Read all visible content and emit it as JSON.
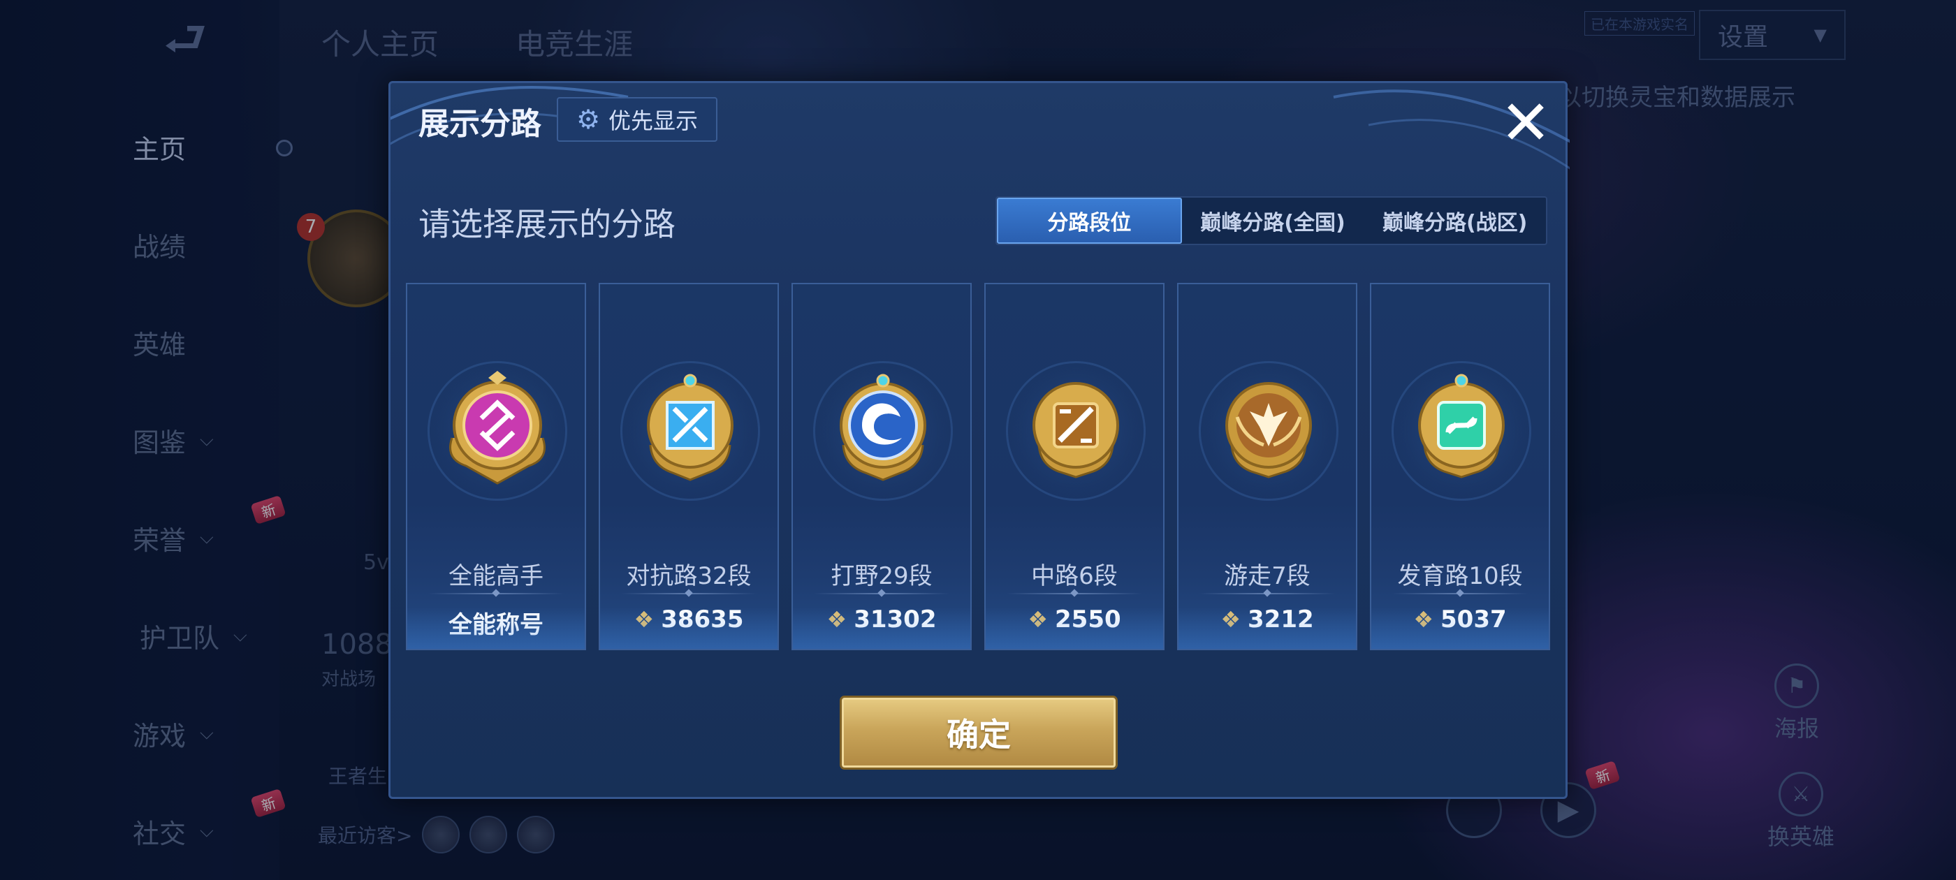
{
  "background": {
    "back_icon": "back-arrow-icon",
    "top_tabs": [
      "个人主页",
      "电竞生涯"
    ],
    "settings_label": "设置",
    "top_tag": "已在本游戏实名",
    "hint_text": "以切换灵宝和数据展示",
    "nav": [
      {
        "label": "主页",
        "has_chevron": false
      },
      {
        "label": "战绩",
        "has_chevron": false
      },
      {
        "label": "英雄",
        "has_chevron": false
      },
      {
        "label": "图鉴",
        "has_chevron": true
      },
      {
        "label": "荣誉",
        "has_chevron": true,
        "badge": "新"
      },
      {
        "label": "护卫队",
        "has_chevron": true
      },
      {
        "label": "游戏",
        "has_chevron": true
      },
      {
        "label": "社交",
        "has_chevron": true,
        "badge": "新"
      }
    ],
    "profile": {
      "level_badge": "7",
      "mode_text": "5v",
      "battle_count": "1088",
      "battle_label": "对战场",
      "kings_label": "王者生"
    },
    "recent_visitors_label": "最近访客>",
    "right_buttons": [
      {
        "label": "海报"
      },
      {
        "label": "换英雄"
      }
    ],
    "new_badge_right": "新"
  },
  "modal": {
    "title": "展示分路",
    "priority_label": "优先显示",
    "close_icon": "close-icon",
    "subtitle": "请选择展示的分路",
    "tabs": [
      {
        "label": "分路段位",
        "active": true
      },
      {
        "label": "巅峰分路(全国)",
        "active": false
      },
      {
        "label": "巅峰分路(战区)",
        "active": false
      }
    ],
    "cards": [
      {
        "name": "全能高手",
        "score": "全能称号",
        "has_points_icon": false,
        "icon": "all-round-badge-icon",
        "accent": "#c93ab0"
      },
      {
        "name": "对抗路32段",
        "score": "38635",
        "has_points_icon": true,
        "icon": "clash-lane-badge-icon",
        "accent": "#3aaef0"
      },
      {
        "name": "打野29段",
        "score": "31302",
        "has_points_icon": true,
        "icon": "jungle-badge-icon",
        "accent": "#3a7fe0"
      },
      {
        "name": "中路6段",
        "score": "2550",
        "has_points_icon": true,
        "icon": "mid-lane-badge-icon",
        "accent": "#c98a3a"
      },
      {
        "name": "游走7段",
        "score": "3212",
        "has_points_icon": true,
        "icon": "roam-badge-icon",
        "accent": "#c98a3a"
      },
      {
        "name": "发育路10段",
        "score": "5037",
        "has_points_icon": true,
        "icon": "farm-lane-badge-icon",
        "accent": "#2fd0a8"
      }
    ],
    "points_icon": "points-diamond-icon",
    "confirm_label": "确定"
  }
}
